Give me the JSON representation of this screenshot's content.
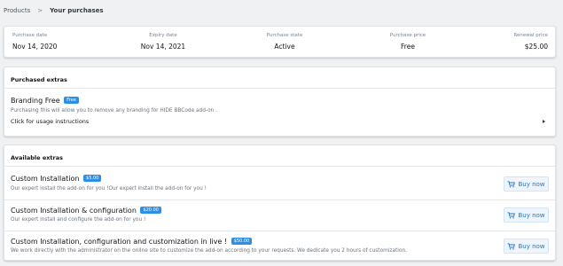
{
  "breadcrumb": {
    "root": "Products",
    "separator": ">",
    "current": "Your purchases"
  },
  "summary": [
    {
      "label": "Purchase date",
      "value": "Nov 14, 2020"
    },
    {
      "label": "Expiry date",
      "value": "Nov 14, 2021"
    },
    {
      "label": "Purchase state",
      "value": "Active"
    },
    {
      "label": "Purchase price",
      "value": "Free"
    },
    {
      "label": "Renewal price",
      "value": "$25.00"
    }
  ],
  "purchased_extras": {
    "title": "Purchased extras",
    "item": {
      "name": "Branding Free",
      "badge": "Free",
      "description": "Purchasing this will allow you to remove any branding for HIDE BBCode add-on ."
    },
    "usage_link": "Click for usage instructions"
  },
  "available_extras": {
    "title": "Available extras",
    "items": [
      {
        "name": "Custom Installation",
        "price": "$5.00",
        "description": "Our expert install the add-on for you !Our expert install the add-on for you !",
        "button": "Buy now"
      },
      {
        "name": "Custom Installation & configuration",
        "price": "$20.00",
        "description": "Our expert install and configure the add-on for you !",
        "button": "Buy now"
      },
      {
        "name": "Custom Installation, configuration and customization in live !",
        "price": "$50.00",
        "description": "We work directly with the administrator on the online site to customize the add-on according to your requests. We dedicate you 2 hours of customization.",
        "button": "Buy now"
      }
    ]
  },
  "colors": {
    "accent": "#2d8fe4",
    "button_text": "#2577c8",
    "background": "#f0f1f3"
  },
  "icons": {
    "breadcrumb_separator": "chevron-right-icon",
    "usage_toggle": "caret-right-icon",
    "buy_button": "cart-icon"
  }
}
